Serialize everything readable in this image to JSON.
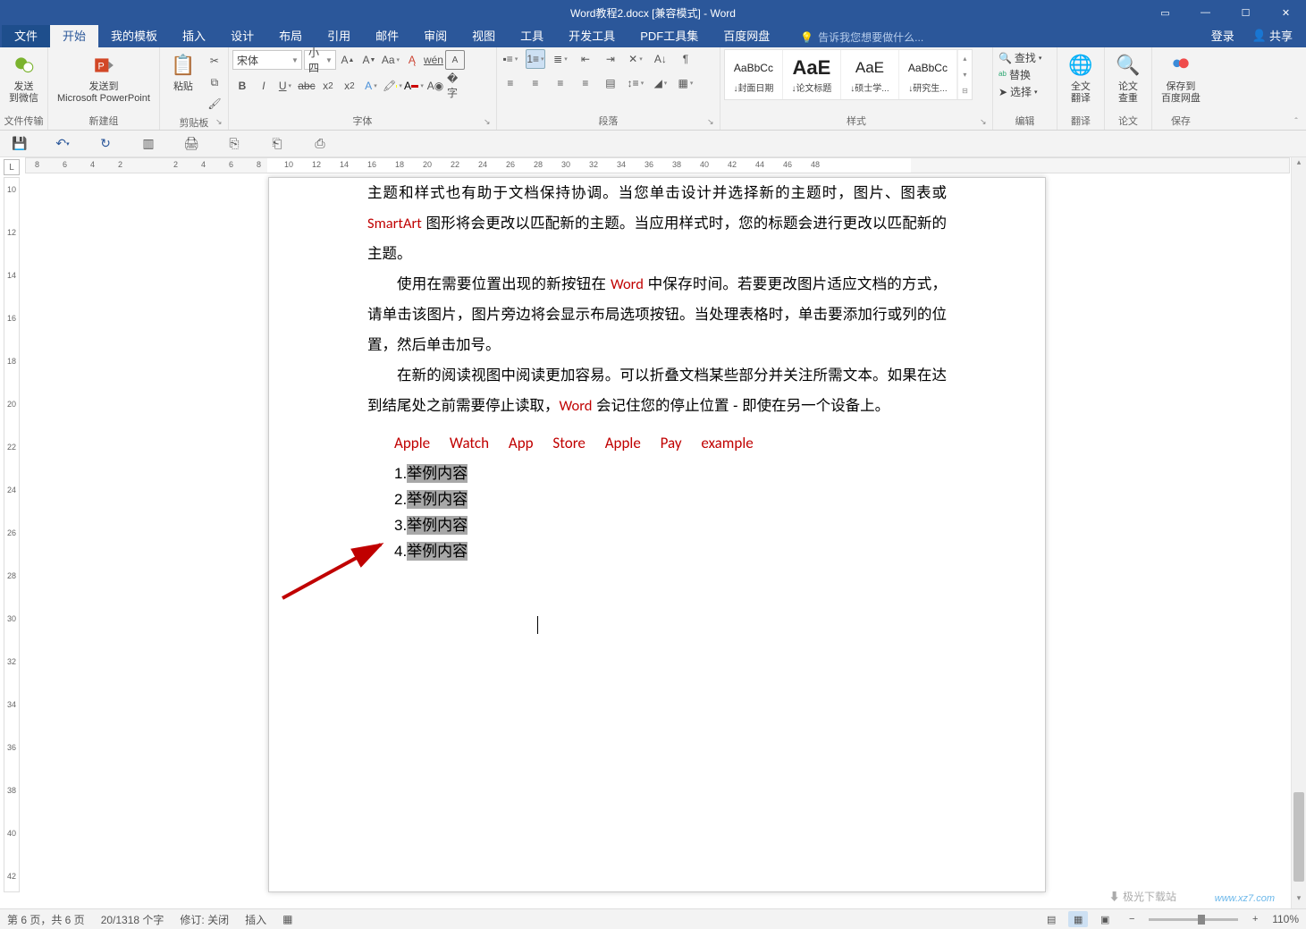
{
  "window": {
    "title": "Word教程2.docx [兼容模式] - Word",
    "login": "登录",
    "share": "共享"
  },
  "tabs": {
    "file": "文件",
    "home": "开始",
    "mytemplates": "我的模板",
    "insert": "插入",
    "design": "设计",
    "layout": "布局",
    "references": "引用",
    "mailings": "邮件",
    "review": "审阅",
    "view": "视图",
    "tools": "工具",
    "devtools": "开发工具",
    "pdftools": "PDF工具集",
    "baidu": "百度网盘",
    "tellme_placeholder": "告诉我您想要做什么..."
  },
  "groups": {
    "filetransfer": {
      "label": "文件传输",
      "send_wechat": "发送\n到微信",
      "send_ppt": "发送到\nMicrosoft PowerPoint"
    },
    "newgroup": {
      "label": "新建组"
    },
    "clipboard": {
      "label": "剪贴板",
      "paste": "粘贴"
    },
    "font": {
      "label": "字体",
      "name": "宋体",
      "size": "小四"
    },
    "paragraph": {
      "label": "段落"
    },
    "styles": {
      "label": "样式",
      "preview": "AaBbCc",
      "preview_big": "AaE",
      "s1": "↓封面日期",
      "s2": "↓论文标题",
      "s3": "↓硕士学...",
      "s4": "↓研究生..."
    },
    "editing": {
      "label": "编辑",
      "find": "查找",
      "replace": "替换",
      "select": "选择"
    },
    "translate": {
      "label": "翻译",
      "btn": "全文\n翻译"
    },
    "thesis": {
      "label": "论文",
      "btn": "论文\n查重"
    },
    "save": {
      "label": "保存",
      "btn": "保存到\n百度网盘"
    }
  },
  "ruler_h": [
    "8",
    "6",
    "4",
    "2",
    "",
    "2",
    "4",
    "6",
    "8",
    "10",
    "12",
    "14",
    "16",
    "18",
    "20",
    "22",
    "24",
    "26",
    "28",
    "30",
    "32",
    "34",
    "36",
    "38",
    "40",
    "42",
    "44",
    "46",
    "48"
  ],
  "ruler_v": [
    "10",
    "12",
    "14",
    "16",
    "18",
    "20",
    "22",
    "24",
    "26",
    "28",
    "30",
    "32",
    "34",
    "36",
    "38",
    "40",
    "42"
  ],
  "document": {
    "p1_a": "主题和样式也有助于文档保持协调。当您单击设计并选择新的主题时，图片、图表或 ",
    "p1_smartart": "SmartArt",
    "p1_b": " 图形将会更改以匹配新的主题。当应用样式时，您的标题会进行更改以匹配新的主题。",
    "p2_a": "使用在需要位置出现的新按钮在 ",
    "p2_word": "Word",
    "p2_b": " 中保存时间。若要更改图片适应文档的方式，请单击该图片，图片旁边将会显示布局选项按钮。当处理表格时，单击要添加行或列的位置，然后单击加号。",
    "p3_a": "在新的阅读视图中阅读更加容易。可以折叠文档某些部分并关注所需文本。如果在达到结尾处之前需要停止读取，",
    "p3_word": "Word",
    "p3_b": " 会记住您的停止位置 - 即使在另一个设备上。",
    "redwords": "Apple Watch   App Store   Apple Pay   example",
    "list": [
      {
        "num": "1.",
        "txt": "举例内容"
      },
      {
        "num": "2.",
        "txt": "举例内容"
      },
      {
        "num": "3.",
        "txt": "举例内容"
      },
      {
        "num": "4.",
        "txt": "举例内容"
      }
    ]
  },
  "status": {
    "page": "第 6 页，共 6 页",
    "words": "20/1318 个字",
    "revisions": "修订: 关闭",
    "insert": "插入",
    "zoom": "110%"
  },
  "watermark": {
    "a": "极光下载站",
    "b": "www.xz7.com"
  }
}
